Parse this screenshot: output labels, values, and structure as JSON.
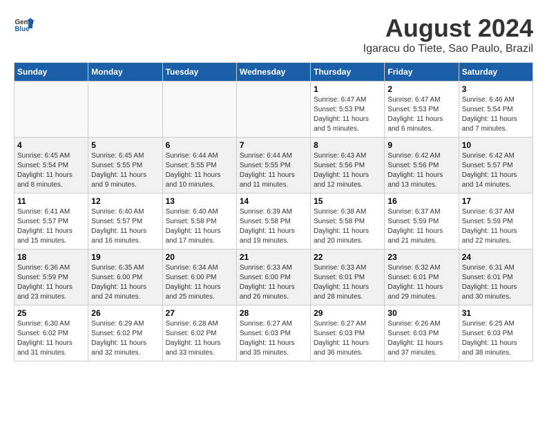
{
  "header": {
    "logo": {
      "general": "General",
      "blue": "Blue"
    },
    "month_year": "August 2024",
    "location": "Igaracu do Tiete, Sao Paulo, Brazil"
  },
  "calendar": {
    "days_of_week": [
      "Sunday",
      "Monday",
      "Tuesday",
      "Wednesday",
      "Thursday",
      "Friday",
      "Saturday"
    ],
    "weeks": [
      [
        {
          "day": "",
          "info": ""
        },
        {
          "day": "",
          "info": ""
        },
        {
          "day": "",
          "info": ""
        },
        {
          "day": "",
          "info": ""
        },
        {
          "day": "1",
          "info": "Sunrise: 6:47 AM\nSunset: 5:53 PM\nDaylight: 11 hours and 5 minutes."
        },
        {
          "day": "2",
          "info": "Sunrise: 6:47 AM\nSunset: 5:53 PM\nDaylight: 11 hours and 6 minutes."
        },
        {
          "day": "3",
          "info": "Sunrise: 6:46 AM\nSunset: 5:54 PM\nDaylight: 11 hours and 7 minutes."
        }
      ],
      [
        {
          "day": "4",
          "info": "Sunrise: 6:45 AM\nSunset: 5:54 PM\nDaylight: 11 hours and 8 minutes."
        },
        {
          "day": "5",
          "info": "Sunrise: 6:45 AM\nSunset: 5:55 PM\nDaylight: 11 hours and 9 minutes."
        },
        {
          "day": "6",
          "info": "Sunrise: 6:44 AM\nSunset: 5:55 PM\nDaylight: 11 hours and 10 minutes."
        },
        {
          "day": "7",
          "info": "Sunrise: 6:44 AM\nSunset: 5:55 PM\nDaylight: 11 hours and 11 minutes."
        },
        {
          "day": "8",
          "info": "Sunrise: 6:43 AM\nSunset: 5:56 PM\nDaylight: 11 hours and 12 minutes."
        },
        {
          "day": "9",
          "info": "Sunrise: 6:42 AM\nSunset: 5:56 PM\nDaylight: 11 hours and 13 minutes."
        },
        {
          "day": "10",
          "info": "Sunrise: 6:42 AM\nSunset: 5:57 PM\nDaylight: 11 hours and 14 minutes."
        }
      ],
      [
        {
          "day": "11",
          "info": "Sunrise: 6:41 AM\nSunset: 5:57 PM\nDaylight: 11 hours and 15 minutes."
        },
        {
          "day": "12",
          "info": "Sunrise: 6:40 AM\nSunset: 5:57 PM\nDaylight: 11 hours and 16 minutes."
        },
        {
          "day": "13",
          "info": "Sunrise: 6:40 AM\nSunset: 5:58 PM\nDaylight: 11 hours and 17 minutes."
        },
        {
          "day": "14",
          "info": "Sunrise: 6:39 AM\nSunset: 5:58 PM\nDaylight: 11 hours and 19 minutes."
        },
        {
          "day": "15",
          "info": "Sunrise: 6:38 AM\nSunset: 5:58 PM\nDaylight: 11 hours and 20 minutes."
        },
        {
          "day": "16",
          "info": "Sunrise: 6:37 AM\nSunset: 5:59 PM\nDaylight: 11 hours and 21 minutes."
        },
        {
          "day": "17",
          "info": "Sunrise: 6:37 AM\nSunset: 5:59 PM\nDaylight: 11 hours and 22 minutes."
        }
      ],
      [
        {
          "day": "18",
          "info": "Sunrise: 6:36 AM\nSunset: 5:59 PM\nDaylight: 11 hours and 23 minutes."
        },
        {
          "day": "19",
          "info": "Sunrise: 6:35 AM\nSunset: 6:00 PM\nDaylight: 11 hours and 24 minutes."
        },
        {
          "day": "20",
          "info": "Sunrise: 6:34 AM\nSunset: 6:00 PM\nDaylight: 11 hours and 25 minutes."
        },
        {
          "day": "21",
          "info": "Sunrise: 6:33 AM\nSunset: 6:00 PM\nDaylight: 11 hours and 26 minutes."
        },
        {
          "day": "22",
          "info": "Sunrise: 6:33 AM\nSunset: 6:01 PM\nDaylight: 11 hours and 28 minutes."
        },
        {
          "day": "23",
          "info": "Sunrise: 6:32 AM\nSunset: 6:01 PM\nDaylight: 11 hours and 29 minutes."
        },
        {
          "day": "24",
          "info": "Sunrise: 6:31 AM\nSunset: 6:01 PM\nDaylight: 11 hours and 30 minutes."
        }
      ],
      [
        {
          "day": "25",
          "info": "Sunrise: 6:30 AM\nSunset: 6:02 PM\nDaylight: 11 hours and 31 minutes."
        },
        {
          "day": "26",
          "info": "Sunrise: 6:29 AM\nSunset: 6:02 PM\nDaylight: 11 hours and 32 minutes."
        },
        {
          "day": "27",
          "info": "Sunrise: 6:28 AM\nSunset: 6:02 PM\nDaylight: 11 hours and 33 minutes."
        },
        {
          "day": "28",
          "info": "Sunrise: 6:27 AM\nSunset: 6:03 PM\nDaylight: 11 hours and 35 minutes."
        },
        {
          "day": "29",
          "info": "Sunrise: 6:27 AM\nSunset: 6:03 PM\nDaylight: 11 hours and 36 minutes."
        },
        {
          "day": "30",
          "info": "Sunrise: 6:26 AM\nSunset: 6:03 PM\nDaylight: 11 hours and 37 minutes."
        },
        {
          "day": "31",
          "info": "Sunrise: 6:25 AM\nSunset: 6:03 PM\nDaylight: 11 hours and 38 minutes."
        }
      ]
    ]
  }
}
